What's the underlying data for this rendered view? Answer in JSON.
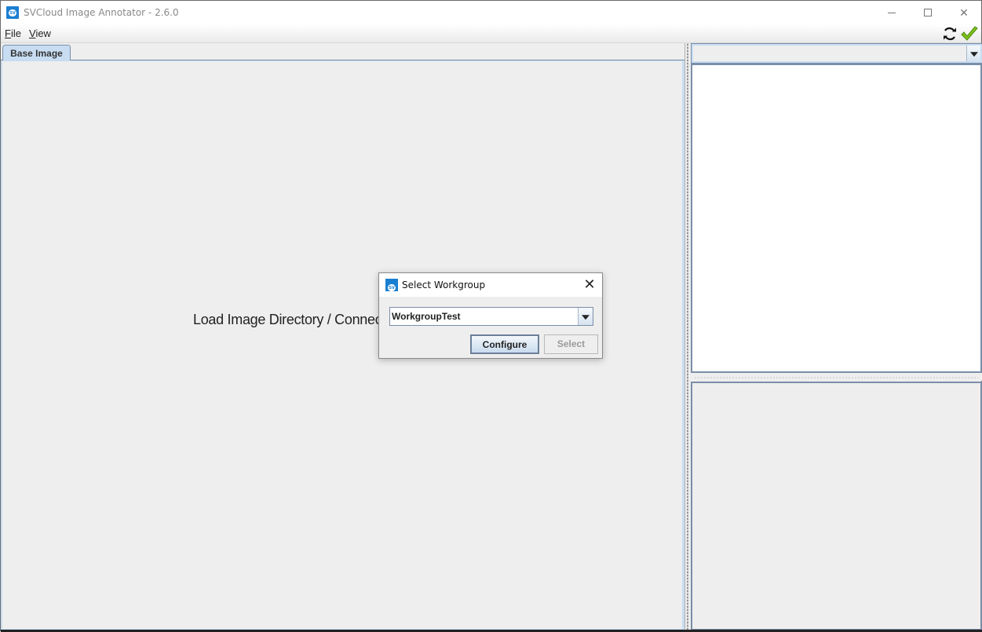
{
  "window": {
    "title": "SVCloud Image Annotator - 2.6.0",
    "app_icon_text": "sv",
    "controls": {
      "minimize": "minimize-icon",
      "maximize": "maximize-icon",
      "close": "✕"
    }
  },
  "menubar": {
    "items": [
      {
        "label": "File",
        "mnemonic": "F",
        "rest": "ile"
      },
      {
        "label": "View",
        "mnemonic": "V",
        "rest": "iew"
      }
    ],
    "toolbar_icons": [
      "refresh-icon",
      "checkmark-icon"
    ],
    "colors": {
      "check_green": "#7cc219"
    }
  },
  "main": {
    "tabs": [
      {
        "label": "Base Image",
        "active": true
      }
    ],
    "placeholder_text": "Load Image Directory / Connect"
  },
  "right_panel": {
    "top_combo_value": "",
    "list_items": []
  },
  "dialog": {
    "title": "Select Workgroup",
    "icon_text": "sv",
    "close_glyph": "✕",
    "workgroup_value": "WorkgroupTest",
    "buttons": {
      "configure": {
        "label": "Configure",
        "enabled": true
      },
      "select": {
        "label": "Select",
        "enabled": false
      }
    }
  }
}
